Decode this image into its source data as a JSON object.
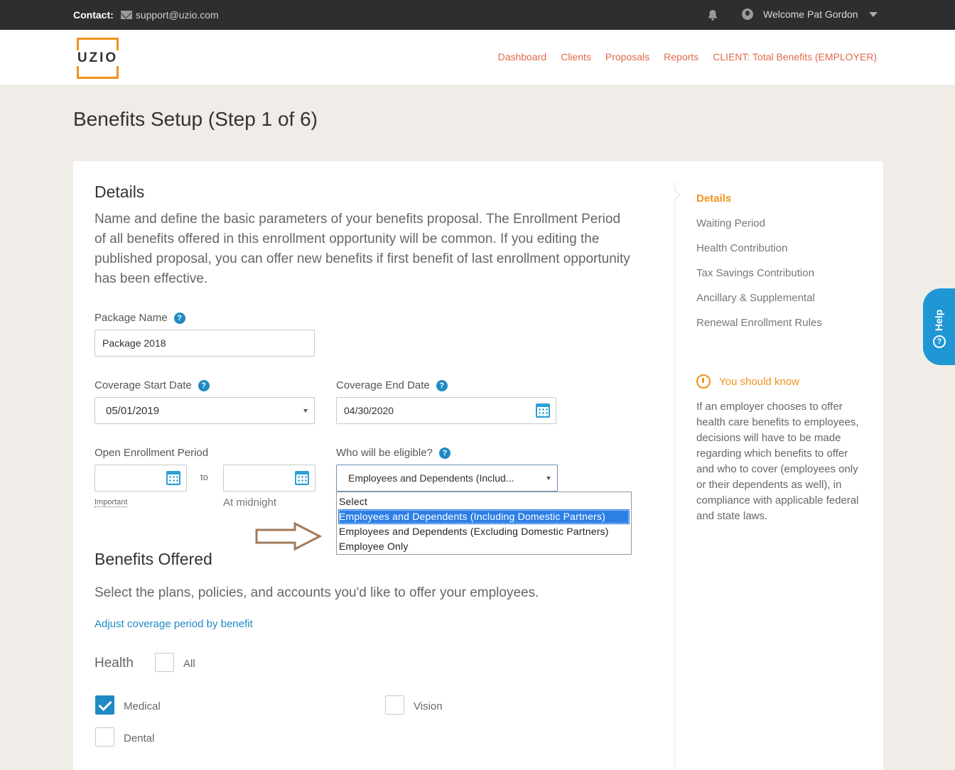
{
  "topbar": {
    "contact_label": "Contact:",
    "email": "support@uzio.com",
    "welcome": "Welcome Pat Gordon"
  },
  "logo": "UZIO",
  "nav": {
    "items": [
      "Dashboard",
      "Clients",
      "Proposals",
      "Reports",
      "CLIENT: Total Benefits (EMPLOYER)"
    ]
  },
  "page_title": "Benefits Setup (Step 1 of 6)",
  "details": {
    "heading": "Details",
    "description": "Name and define the basic parameters of your benefits proposal. The Enrollment Period of all benefits offered in this enrollment opportunity will be common. If you editing the published proposal, you can offer new benefits if first benefit of last enrollment opportunity has been effective.",
    "package_name_label": "Package Name",
    "package_name_value": "Package 2018",
    "coverage_start_label": "Coverage Start Date",
    "coverage_start_value": "05/01/2019",
    "coverage_end_label": "Coverage End Date",
    "coverage_end_value": "04/30/2020",
    "open_enrollment_label": "Open Enrollment Period",
    "to_label": "to",
    "important_label": "Important",
    "midnight_label": "At midnight",
    "eligible_label": "Who will be eligible?",
    "eligible_value": "Employees and Dependents (Includ...",
    "eligible_options": [
      "Select",
      "Employees and Dependents (Including Domestic Partners)",
      "Employees and Dependents (Excluding Domestic Partners)",
      "Employee Only"
    ],
    "help_glyph": "?"
  },
  "benefits": {
    "heading": "Benefits Offered",
    "description": "Select the plans, policies, and accounts you'd like to offer your employees.",
    "adjust_link": "Adjust coverage period by benefit",
    "health_label": "Health",
    "all_label": "All",
    "medical_label": "Medical",
    "vision_label": "Vision",
    "dental_label": "Dental"
  },
  "sidebar": {
    "steps": [
      "Details",
      "Waiting Period",
      "Health Contribution",
      "Tax Savings Contribution",
      "Ancillary & Supplemental",
      "Renewal Enrollment Rules"
    ],
    "know_title": "You should know",
    "know_text": "If an employer chooses to offer health care benefits to employees, decisions will have to be made regarding which benefits to offer and who to cover (employees only or their dependents as well), in compliance with applicable federal and state laws."
  },
  "help_tab": {
    "label": "Help",
    "icon_glyph": "?"
  },
  "colors": {
    "accent_orange": "#f0921e",
    "link_blue": "#1f8ac3",
    "nav_red": "#e06a4a",
    "topbar": "#2e2e30"
  }
}
